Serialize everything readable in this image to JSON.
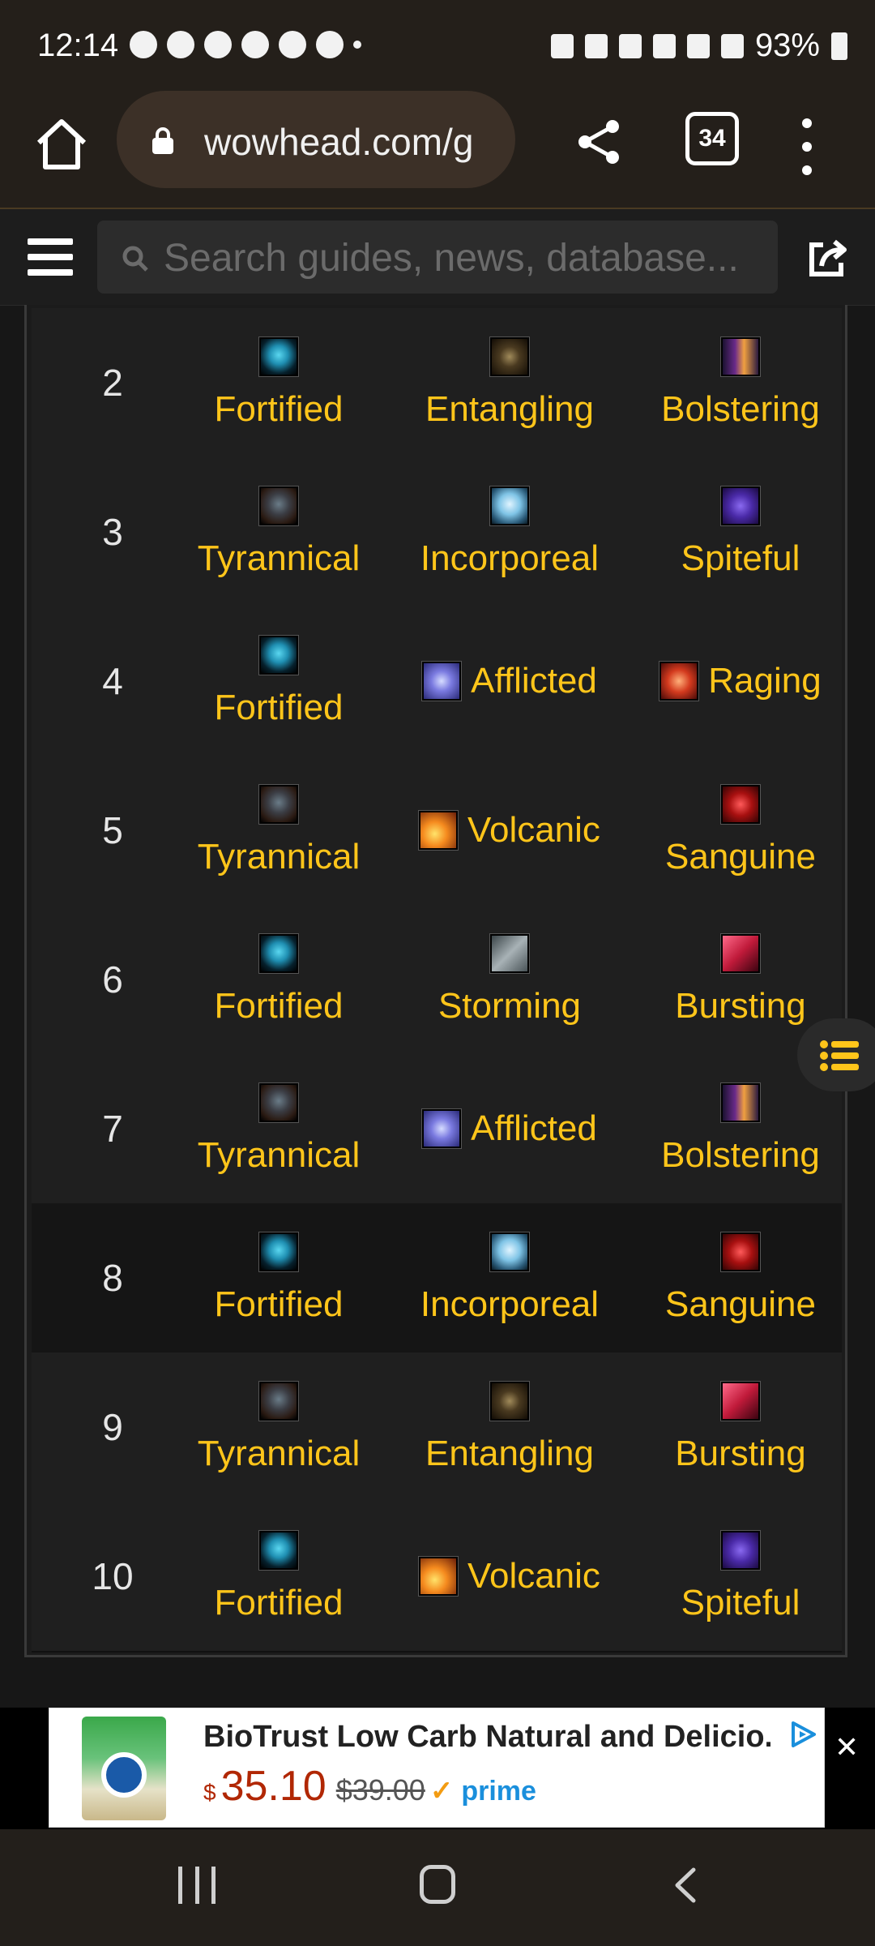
{
  "status_bar": {
    "time": "12:14",
    "battery": "93%"
  },
  "browser": {
    "url": "wowhead.com/g",
    "tab_count": "34"
  },
  "site_header": {
    "search_placeholder": "Search guides, news, database..."
  },
  "affix_table": {
    "rows": [
      {
        "level": "2",
        "affixes": [
          {
            "name": "Fortified",
            "icon": "fortified-icon",
            "layout": "stack"
          },
          {
            "name": "Entangling",
            "icon": "entangling-icon",
            "layout": "stack"
          },
          {
            "name": "Bolstering",
            "icon": "bolstering-icon",
            "layout": "stack"
          }
        ]
      },
      {
        "level": "3",
        "affixes": [
          {
            "name": "Tyrannical",
            "icon": "tyrannical-icon",
            "layout": "stack"
          },
          {
            "name": "Incorporeal",
            "icon": "incorporeal-icon",
            "layout": "stack"
          },
          {
            "name": "Spiteful",
            "icon": "spiteful-icon",
            "layout": "stack"
          }
        ]
      },
      {
        "level": "4",
        "affixes": [
          {
            "name": "Fortified",
            "icon": "fortified-icon",
            "layout": "stack"
          },
          {
            "name": "Afflicted",
            "icon": "afflicted-icon",
            "layout": "inline"
          },
          {
            "name": "Raging",
            "icon": "raging-icon",
            "layout": "inline"
          }
        ]
      },
      {
        "level": "5",
        "affixes": [
          {
            "name": "Tyrannical",
            "icon": "tyrannical-icon",
            "layout": "stack"
          },
          {
            "name": "Volcanic",
            "icon": "volcanic-icon",
            "layout": "inline"
          },
          {
            "name": "Sanguine",
            "icon": "sanguine-icon",
            "layout": "stack"
          }
        ]
      },
      {
        "level": "6",
        "affixes": [
          {
            "name": "Fortified",
            "icon": "fortified-icon",
            "layout": "stack"
          },
          {
            "name": "Storming",
            "icon": "storming-icon",
            "layout": "stack"
          },
          {
            "name": "Bursting",
            "icon": "bursting-icon",
            "layout": "stack"
          }
        ]
      },
      {
        "level": "7",
        "affixes": [
          {
            "name": "Tyrannical",
            "icon": "tyrannical-icon",
            "layout": "stack"
          },
          {
            "name": "Afflicted",
            "icon": "afflicted-icon",
            "layout": "inline"
          },
          {
            "name": "Bolstering",
            "icon": "bolstering-icon",
            "layout": "stack"
          }
        ]
      },
      {
        "level": "8",
        "affixes": [
          {
            "name": "Fortified",
            "icon": "fortified-icon",
            "layout": "stack"
          },
          {
            "name": "Incorporeal",
            "icon": "incorporeal-icon",
            "layout": "stack"
          },
          {
            "name": "Sanguine",
            "icon": "sanguine-icon",
            "layout": "stack"
          }
        ]
      },
      {
        "level": "9",
        "affixes": [
          {
            "name": "Tyrannical",
            "icon": "tyrannical-icon",
            "layout": "stack"
          },
          {
            "name": "Entangling",
            "icon": "entangling-icon",
            "layout": "stack"
          },
          {
            "name": "Bursting",
            "icon": "bursting-icon",
            "layout": "stack"
          }
        ]
      },
      {
        "level": "10",
        "affixes": [
          {
            "name": "Fortified",
            "icon": "fortified-icon",
            "layout": "stack"
          },
          {
            "name": "Volcanic",
            "icon": "volcanic-icon",
            "layout": "inline"
          },
          {
            "name": "Spiteful",
            "icon": "spiteful-icon",
            "layout": "stack"
          }
        ]
      }
    ]
  },
  "ad": {
    "title": "BioTrust Low Carb Natural and Delicio.",
    "currency": "$",
    "price": "35.10",
    "old_price": "$39.00",
    "prime_check": "✓",
    "prime": "prime",
    "close": "✕"
  },
  "colors": {
    "link": "#ffc51a",
    "background": "#171717"
  }
}
